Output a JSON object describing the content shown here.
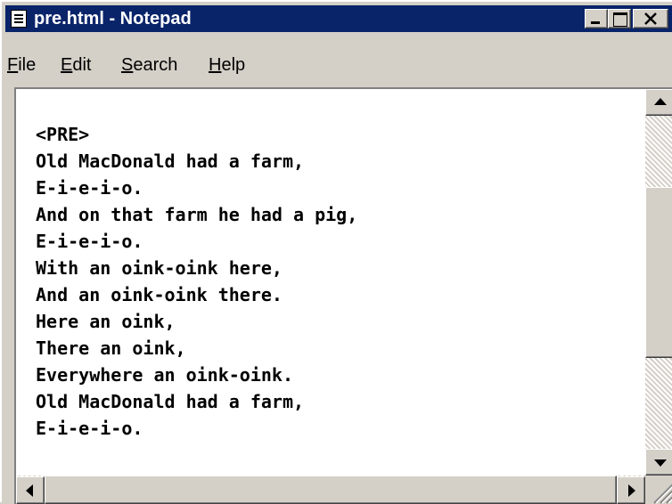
{
  "window": {
    "title": "pre.html - Notepad",
    "title_icon": "notepad-icon",
    "controls": {
      "minimize": "minimize-icon",
      "maximize": "maximize-icon",
      "close": "close-icon"
    }
  },
  "menu": {
    "items": [
      {
        "label": "File"
      },
      {
        "label": "Edit"
      },
      {
        "label": "Search"
      },
      {
        "label": "Help"
      }
    ]
  },
  "editor": {
    "content": "<PRE>\nOld MacDonald had a farm,\nE-i-e-i-o.\nAnd on that farm he had a pig,\nE-i-e-i-o.\nWith an oink-oink here,\nAnd an oink-oink there.\nHere an oink,\nThere an oink,\nEverywhere an oink-oink.\nOld MacDonald had a farm,\nE-i-e-i-o."
  },
  "colors": {
    "titlebar": "#0a246a",
    "face": "#d4d0c8"
  }
}
